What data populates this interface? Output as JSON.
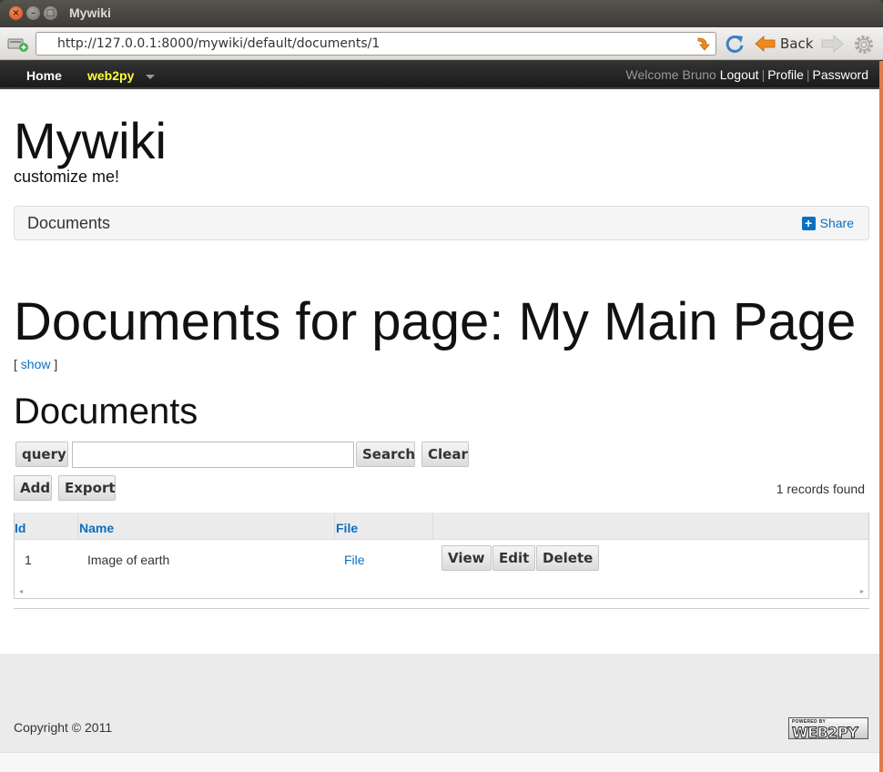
{
  "window": {
    "title": "Mywiki"
  },
  "browser": {
    "url": "http://127.0.0.1:8000/mywiki/default/documents/1",
    "back_label": "Back"
  },
  "navbar": {
    "home": "Home",
    "app": "web2py",
    "welcome": "Welcome Bruno",
    "logout": "Logout",
    "profile": "Profile",
    "password": "Password"
  },
  "site": {
    "title": "Mywiki",
    "subtitle": "customize me!"
  },
  "breadcrumb": {
    "title": "Documents",
    "share": "Share"
  },
  "page": {
    "heading": "Documents for page: My Main Page",
    "show_prefix": "[",
    "show_link": "show",
    "show_suffix": "]",
    "section_heading": "Documents"
  },
  "search": {
    "query_label": "query",
    "value": "",
    "search_label": "Search",
    "clear_label": "Clear"
  },
  "grid_actions": {
    "add": "Add",
    "export": "Export",
    "records": "1 records found"
  },
  "grid": {
    "columns": [
      "Id",
      "Name",
      "File"
    ],
    "rows": [
      {
        "id": "1",
        "name": "Image of earth",
        "file": "File"
      }
    ],
    "row_actions": {
      "view": "View",
      "edit": "Edit",
      "delete": "Delete"
    }
  },
  "footer": {
    "copyright": "Copyright © 2011",
    "badge_small": "POWERED BY",
    "badge_big": "WEB2PY"
  },
  "colors": {
    "link": "#0a6fc2",
    "app_name": "#ffff33",
    "navbar": "#1a1a1a",
    "scroll_edge": "#e07a4a"
  }
}
